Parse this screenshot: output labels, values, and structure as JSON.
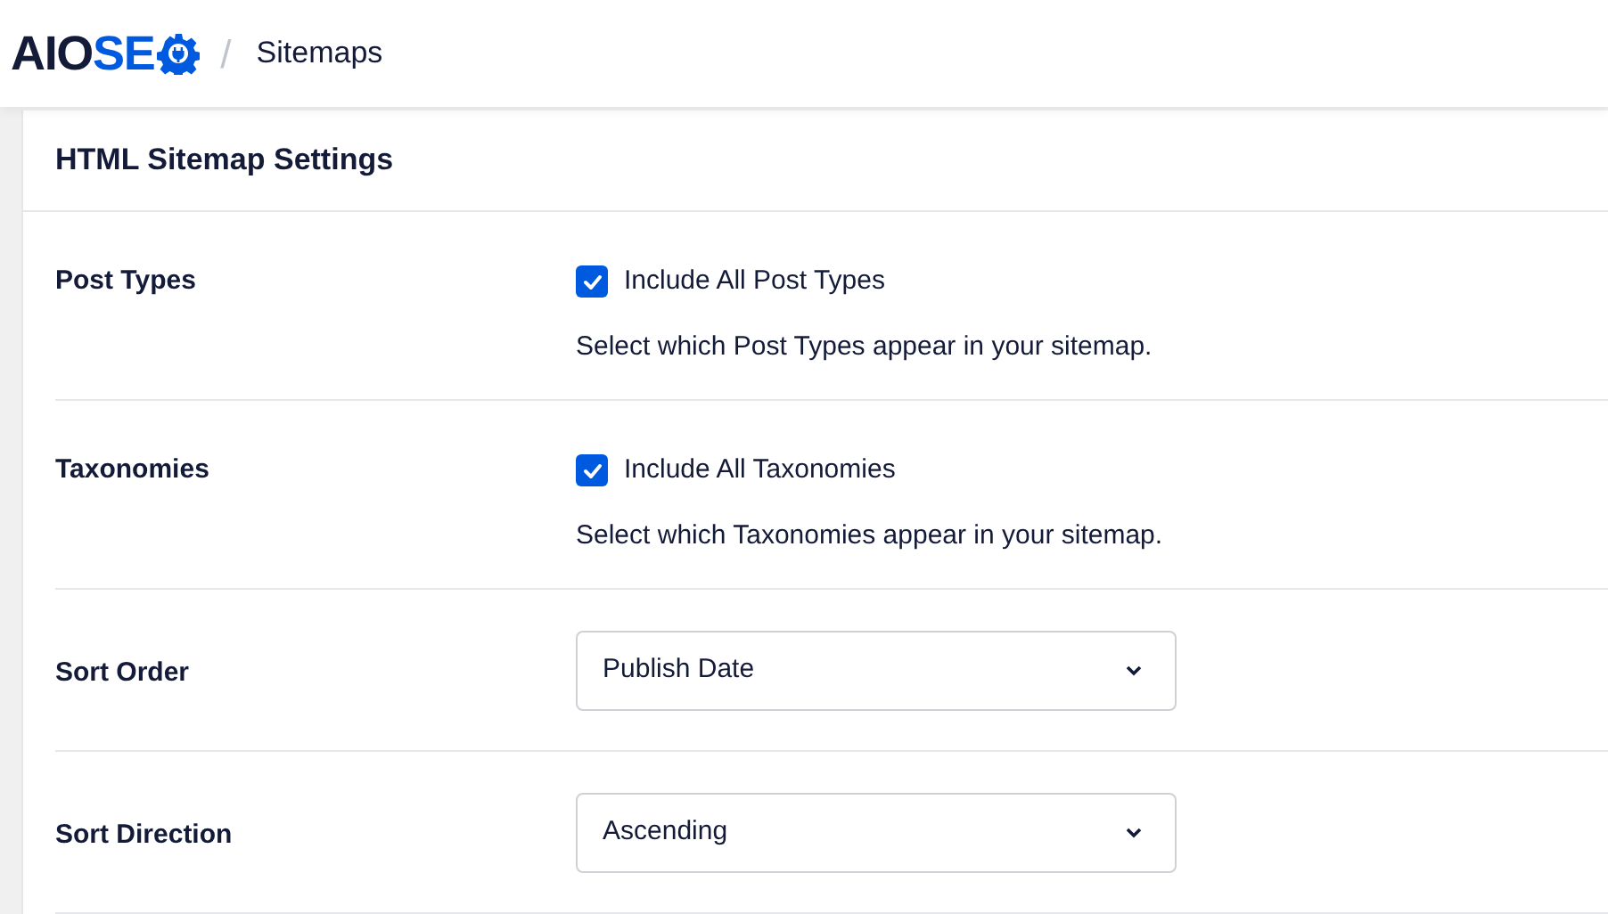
{
  "header": {
    "logo": {
      "dark": "AIO",
      "accent": "SE"
    },
    "separator": "/",
    "breadcrumb": "Sitemaps"
  },
  "card": {
    "title": "HTML Sitemap Settings",
    "rows": [
      {
        "kind": "checkbox",
        "label": "Post Types",
        "option": "Include All Post Types",
        "checked": true,
        "description": "Select which Post Types appear in your sitemap."
      },
      {
        "kind": "checkbox",
        "label": "Taxonomies",
        "option": "Include All Taxonomies",
        "checked": true,
        "description": "Select which Taxonomies appear in your sitemap."
      },
      {
        "kind": "select",
        "label": "Sort Order",
        "value": "Publish Date"
      },
      {
        "kind": "select",
        "label": "Sort Direction",
        "value": "Ascending"
      }
    ]
  }
}
